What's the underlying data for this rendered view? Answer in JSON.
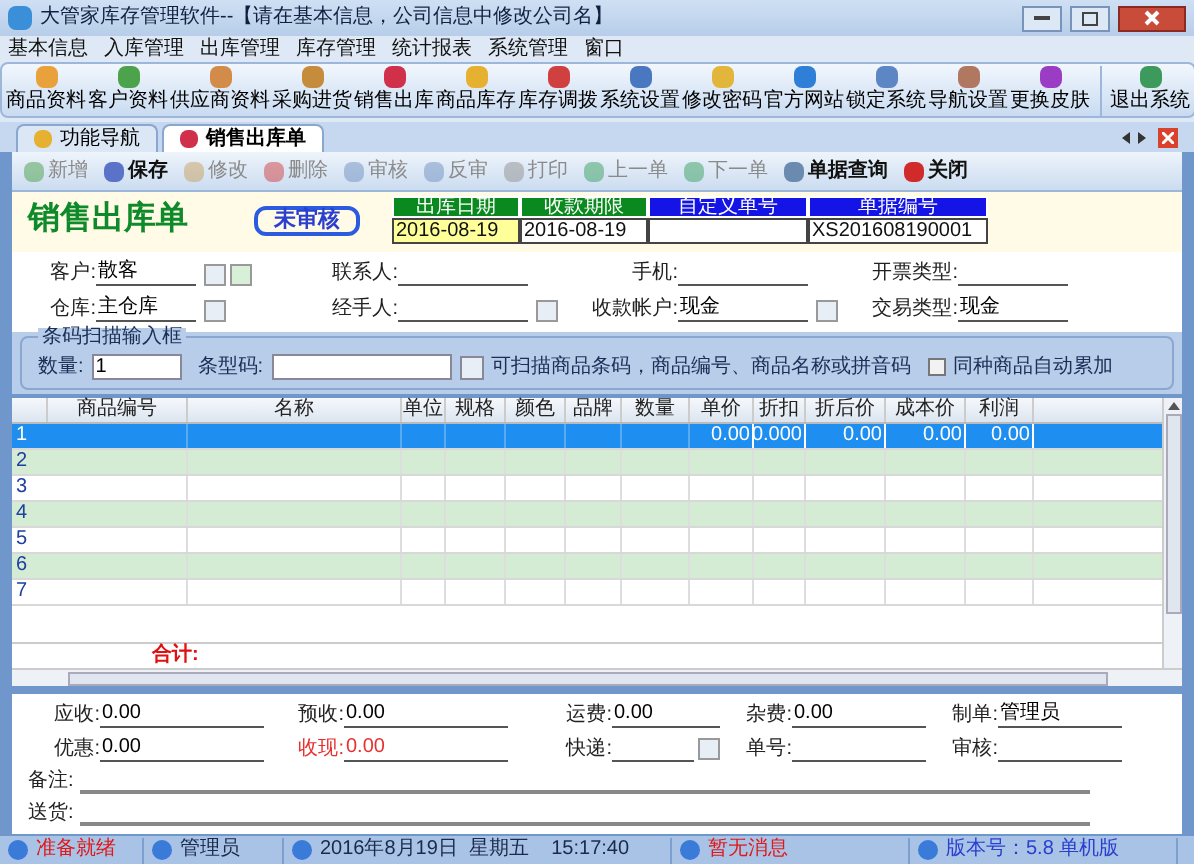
{
  "window": {
    "title": "大管家库存管理软件--【请在基本信息，公司信息中修改公司名】"
  },
  "menu": [
    "基本信息",
    "入库管理",
    "出库管理",
    "库存管理",
    "统计报表",
    "系统管理",
    "窗口"
  ],
  "toolbar": [
    {
      "label": "商品资料"
    },
    {
      "label": "客户资料"
    },
    {
      "label": "供应商资料"
    },
    {
      "label": "采购进货"
    },
    {
      "label": "销售出库"
    },
    {
      "label": "商品库存"
    },
    {
      "label": "库存调拨"
    },
    {
      "label": "系统设置"
    },
    {
      "label": "修改密码"
    },
    {
      "label": "官方网站"
    },
    {
      "label": "锁定系统"
    },
    {
      "label": "导航设置"
    },
    {
      "label": "更换皮肤"
    },
    {
      "label": "退出系统"
    }
  ],
  "tabs": [
    {
      "label": "功能导航",
      "selected": false
    },
    {
      "label": "销售出库单",
      "selected": true
    }
  ],
  "doc_toolbar": [
    {
      "label": "新增",
      "disabled": true
    },
    {
      "label": "保存",
      "disabled": false
    },
    {
      "label": "修改",
      "disabled": true
    },
    {
      "label": "删除",
      "disabled": true
    },
    {
      "label": "审核",
      "disabled": true
    },
    {
      "label": "反审",
      "disabled": true
    },
    {
      "label": "打印",
      "disabled": true
    },
    {
      "label": "上一单",
      "disabled": true
    },
    {
      "label": "下一单",
      "disabled": true
    },
    {
      "label": "单据查询",
      "disabled": false
    },
    {
      "label": "关闭",
      "disabled": false
    }
  ],
  "header": {
    "title": "销售出库单",
    "stamp": "未审核",
    "fields": [
      {
        "label": "出库日期",
        "value": "2016-08-19"
      },
      {
        "label": "收款期限",
        "value": "2016-08-19"
      },
      {
        "label": "自定义单号"
      },
      {
        "label": "单据编号",
        "value": "XS201608190001"
      }
    ]
  },
  "form": [
    [
      {
        "label": "客户:",
        "value": "散客"
      },
      {
        "label": "联系人:"
      },
      {
        "label": "手机:"
      },
      {
        "label": "开票类型:"
      }
    ],
    [
      {
        "label": "仓库:",
        "value": "主仓库"
      },
      {
        "label": "经手人:"
      },
      {
        "label": "收款帐户:",
        "value": "现金"
      },
      {
        "label": "交易类型:",
        "value": "现金"
      }
    ]
  ],
  "barcode": {
    "legend": "条码扫描输入框",
    "qty_label": "数量:",
    "qty": "1",
    "code_label": "条型码:",
    "hint": "可扫描商品条码，商品编号、商品名称或拼音码",
    "checkbox": {
      "label": "同种商品自动累加",
      "checked": false
    }
  },
  "table": {
    "columns": [
      "商品编号",
      "名称",
      "单位",
      "规格",
      "颜色",
      "品牌",
      "数量",
      "单价",
      "折扣",
      "折后价",
      "成本价",
      "利润"
    ],
    "rows": [
      {
        "no": "1",
        "selected": true,
        "values": [
          "0.00",
          "0.000",
          "0.00",
          "0.00",
          "0.00"
        ]
      },
      {
        "no": "2",
        "selected": false
      },
      {
        "no": "3",
        "selected": false
      },
      {
        "no": "4",
        "selected": false
      },
      {
        "no": "5",
        "selected": false
      },
      {
        "no": "6",
        "selected": false
      },
      {
        "no": "7",
        "selected": false
      }
    ],
    "total": "合计:"
  },
  "footer": [
    [
      {
        "label": "应收:",
        "value": "0.00"
      },
      {
        "label": "预收:",
        "value": "0.00"
      },
      {
        "label": "运费:",
        "value": "0.00"
      },
      {
        "label": "杂费:",
        "value": "0.00"
      },
      {
        "label": "制单:",
        "value": "管理员"
      }
    ],
    [
      {
        "label": "优惠:",
        "value": "0.00"
      },
      {
        "label": "收现:",
        "value": "0.00",
        "highlight": true
      },
      {
        "label": "快递:",
        "picker": true
      },
      {
        "label": "单号:"
      },
      {
        "label": "审核:"
      }
    ]
  ],
  "notes": [
    {
      "label": "备注:"
    },
    {
      "label": "送货:"
    }
  ],
  "status_bar": [
    {
      "text": "准备就绪",
      "kind": "alert"
    },
    {
      "text": "管理员",
      "kind": "normal"
    },
    {
      "text": "2016年8月19日  星期五    15:17:40",
      "kind": "normal"
    },
    {
      "text": "暂无消息",
      "kind": "alert"
    },
    {
      "text": "版本号：5.8 单机版",
      "kind": "info"
    }
  ]
}
